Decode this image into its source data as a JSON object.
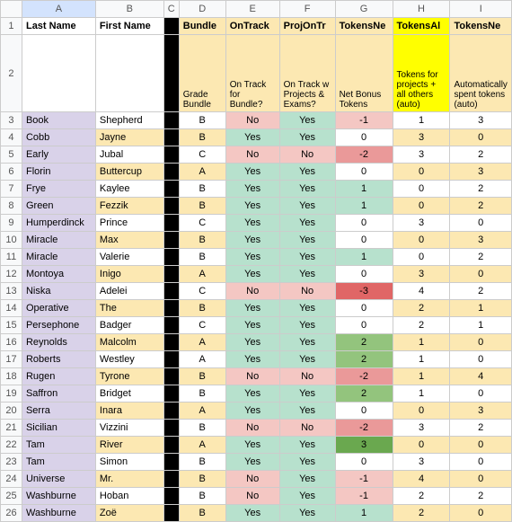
{
  "cols": [
    "",
    "A",
    "B",
    "C",
    "D",
    "E",
    "F",
    "G",
    "H",
    "I"
  ],
  "h1": {
    "A": "Last Name",
    "B": "First Name",
    "D": "Bundle",
    "E": "OnTrack",
    "F": "ProjOnTr",
    "G": "TokensNe",
    "H": "TokensAl",
    "I": "TokensNe"
  },
  "h2": {
    "D": "Grade Bundle",
    "E": "On Track for Bundle?",
    "F": "On Track w Projects & Exams?",
    "G": "Net Bonus Tokens",
    "H": "Tokens for projects + all others (auto)",
    "I": "Automatically spent tokens (auto)"
  },
  "rows": [
    {
      "n": "3",
      "ln": "Book",
      "fn": "Shepherd",
      "b": "B",
      "ot": "No",
      "pt": "Yes",
      "nt": -1,
      "ta": 1,
      "ts": 3
    },
    {
      "n": "4",
      "ln": "Cobb",
      "fn": "Jayne",
      "b": "B",
      "ot": "Yes",
      "pt": "Yes",
      "nt": 0,
      "ta": 3,
      "ts": 0
    },
    {
      "n": "5",
      "ln": "Early",
      "fn": "Jubal",
      "b": "C",
      "ot": "No",
      "pt": "No",
      "nt": -2,
      "ta": 3,
      "ts": 2
    },
    {
      "n": "6",
      "ln": "Florin",
      "fn": "Buttercup",
      "b": "A",
      "ot": "Yes",
      "pt": "Yes",
      "nt": 0,
      "ta": 0,
      "ts": 3
    },
    {
      "n": "7",
      "ln": "Frye",
      "fn": "Kaylee",
      "b": "B",
      "ot": "Yes",
      "pt": "Yes",
      "nt": 1,
      "ta": 0,
      "ts": 2
    },
    {
      "n": "8",
      "ln": "Green",
      "fn": "Fezzik",
      "b": "B",
      "ot": "Yes",
      "pt": "Yes",
      "nt": 1,
      "ta": 0,
      "ts": 2
    },
    {
      "n": "9",
      "ln": "Humperdinck",
      "fn": "Prince",
      "b": "C",
      "ot": "Yes",
      "pt": "Yes",
      "nt": 0,
      "ta": 3,
      "ts": 0
    },
    {
      "n": "10",
      "ln": "Miracle",
      "fn": "Max",
      "b": "B",
      "ot": "Yes",
      "pt": "Yes",
      "nt": 0,
      "ta": 0,
      "ts": 3
    },
    {
      "n": "11",
      "ln": "Miracle",
      "fn": "Valerie",
      "b": "B",
      "ot": "Yes",
      "pt": "Yes",
      "nt": 1,
      "ta": 0,
      "ts": 2
    },
    {
      "n": "12",
      "ln": "Montoya",
      "fn": "Inigo",
      "b": "A",
      "ot": "Yes",
      "pt": "Yes",
      "nt": 0,
      "ta": 3,
      "ts": 0
    },
    {
      "n": "13",
      "ln": "Niska",
      "fn": "Adelei",
      "b": "C",
      "ot": "No",
      "pt": "No",
      "nt": -3,
      "ta": 4,
      "ts": 2
    },
    {
      "n": "14",
      "ln": "Operative",
      "fn": "The",
      "b": "B",
      "ot": "Yes",
      "pt": "Yes",
      "nt": 0,
      "ta": 2,
      "ts": 1
    },
    {
      "n": "15",
      "ln": "Persephone",
      "fn": "Badger",
      "b": "C",
      "ot": "Yes",
      "pt": "Yes",
      "nt": 0,
      "ta": 2,
      "ts": 1
    },
    {
      "n": "16",
      "ln": "Reynolds",
      "fn": "Malcolm",
      "b": "A",
      "ot": "Yes",
      "pt": "Yes",
      "nt": 2,
      "ta": 1,
      "ts": 0
    },
    {
      "n": "17",
      "ln": "Roberts",
      "fn": "Westley",
      "b": "A",
      "ot": "Yes",
      "pt": "Yes",
      "nt": 2,
      "ta": 1,
      "ts": 0
    },
    {
      "n": "18",
      "ln": "Rugen",
      "fn": "Tyrone",
      "b": "B",
      "ot": "No",
      "pt": "No",
      "nt": -2,
      "ta": 1,
      "ts": 4
    },
    {
      "n": "19",
      "ln": "Saffron",
      "fn": "Bridget",
      "b": "B",
      "ot": "Yes",
      "pt": "Yes",
      "nt": 2,
      "ta": 1,
      "ts": 0
    },
    {
      "n": "20",
      "ln": "Serra",
      "fn": "Inara",
      "b": "A",
      "ot": "Yes",
      "pt": "Yes",
      "nt": 0,
      "ta": 0,
      "ts": 3
    },
    {
      "n": "21",
      "ln": "Sicilian",
      "fn": "Vizzini",
      "b": "B",
      "ot": "No",
      "pt": "No",
      "nt": -2,
      "ta": 3,
      "ts": 2
    },
    {
      "n": "22",
      "ln": "Tam",
      "fn": "River",
      "b": "A",
      "ot": "Yes",
      "pt": "Yes",
      "nt": 3,
      "ta": 0,
      "ts": 0
    },
    {
      "n": "23",
      "ln": "Tam",
      "fn": "Simon",
      "b": "B",
      "ot": "Yes",
      "pt": "Yes",
      "nt": 0,
      "ta": 3,
      "ts": 0
    },
    {
      "n": "24",
      "ln": "Universe",
      "fn": "Mr.",
      "b": "B",
      "ot": "No",
      "pt": "Yes",
      "nt": -1,
      "ta": 4,
      "ts": 0
    },
    {
      "n": "25",
      "ln": "Washburne",
      "fn": "Hoban",
      "b": "B",
      "ot": "No",
      "pt": "Yes",
      "nt": -1,
      "ta": 2,
      "ts": 2
    },
    {
      "n": "26",
      "ln": "Washburne",
      "fn": "Zoë",
      "b": "B",
      "ot": "Yes",
      "pt": "Yes",
      "nt": 1,
      "ta": 2,
      "ts": 0
    }
  ]
}
